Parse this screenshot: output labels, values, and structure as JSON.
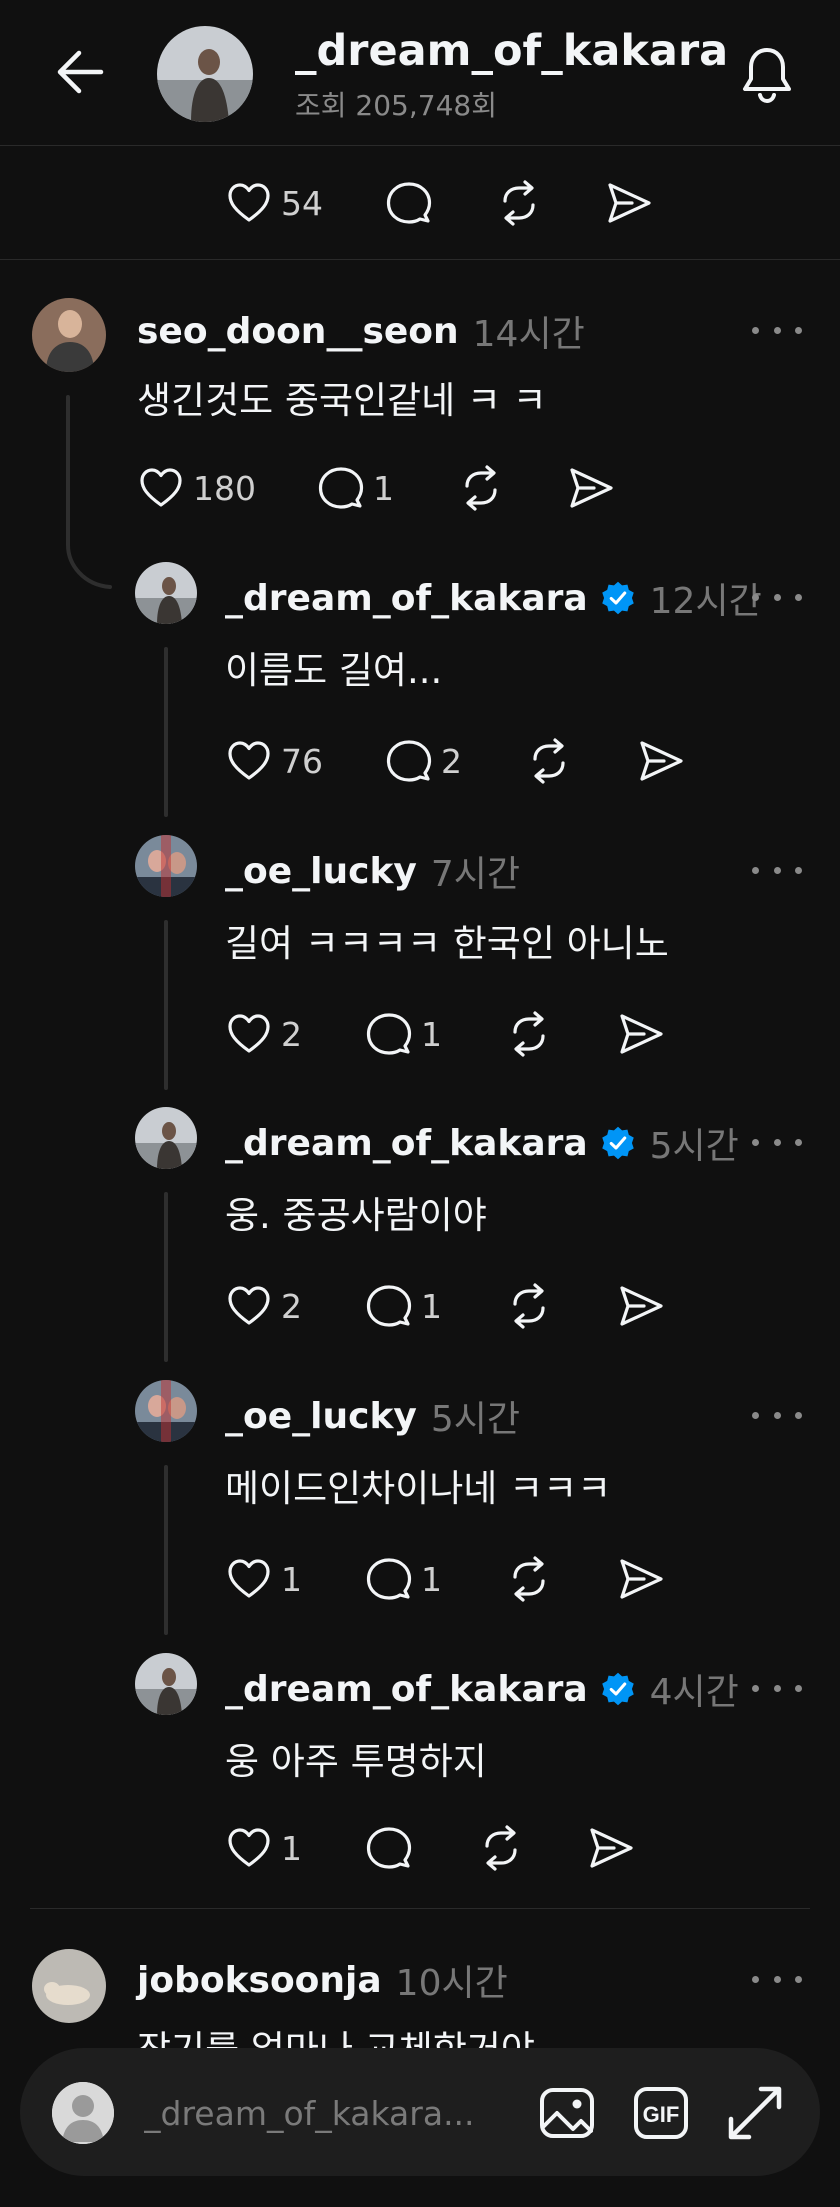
{
  "header": {
    "title": "_dream_of_kakara",
    "views": "조회 205,748회"
  },
  "top_actions": {
    "likes": "54"
  },
  "comments": [
    {
      "user": "seo_doon__seon",
      "time": "14시간",
      "verified": false,
      "text": "생긴것도 중국인같네 ㅋ ㅋ",
      "likes": "180",
      "replies": "1"
    },
    {
      "user": "_dream_of_kakara",
      "time": "12시간",
      "verified": true,
      "text": "이름도 길여...",
      "likes": "76",
      "replies": "2"
    },
    {
      "user": "_oe_lucky",
      "time": "7시간",
      "verified": false,
      "text": "길여 ㅋㅋㅋㅋ 한국인 아니노",
      "likes": "2",
      "replies": "1"
    },
    {
      "user": "_dream_of_kakara",
      "time": "5시간",
      "verified": true,
      "text": "웅. 중공사람이야",
      "likes": "2",
      "replies": "1"
    },
    {
      "user": "_oe_lucky",
      "time": "5시간",
      "verified": false,
      "text": "메이드인차이나네 ㅋㅋㅋ",
      "likes": "1",
      "replies": "1"
    },
    {
      "user": "_dream_of_kakara",
      "time": "4시간",
      "verified": true,
      "text": "웅 아주 투명하지",
      "likes": "1",
      "replies": ""
    },
    {
      "user": "joboksoonja",
      "time": "10시간",
      "verified": false,
      "text": "장기를 얼마나 교체한거야"
    }
  ],
  "composer": {
    "placeholder": "_dream_of_kakara..."
  },
  "icons": {
    "back": "arrow-left-icon",
    "bell": "bell-icon",
    "like": "heart-icon",
    "reply": "speech-bubble-icon",
    "repost": "repost-icon",
    "share": "send-icon",
    "more": "more-dots-icon",
    "verified": "verified-badge-icon",
    "image": "image-icon",
    "gif": "gif-icon",
    "expand": "expand-icon"
  },
  "colors": {
    "background": "#101010",
    "text": "#f3f5f7",
    "muted": "#777777",
    "verified": "#0095f6"
  }
}
